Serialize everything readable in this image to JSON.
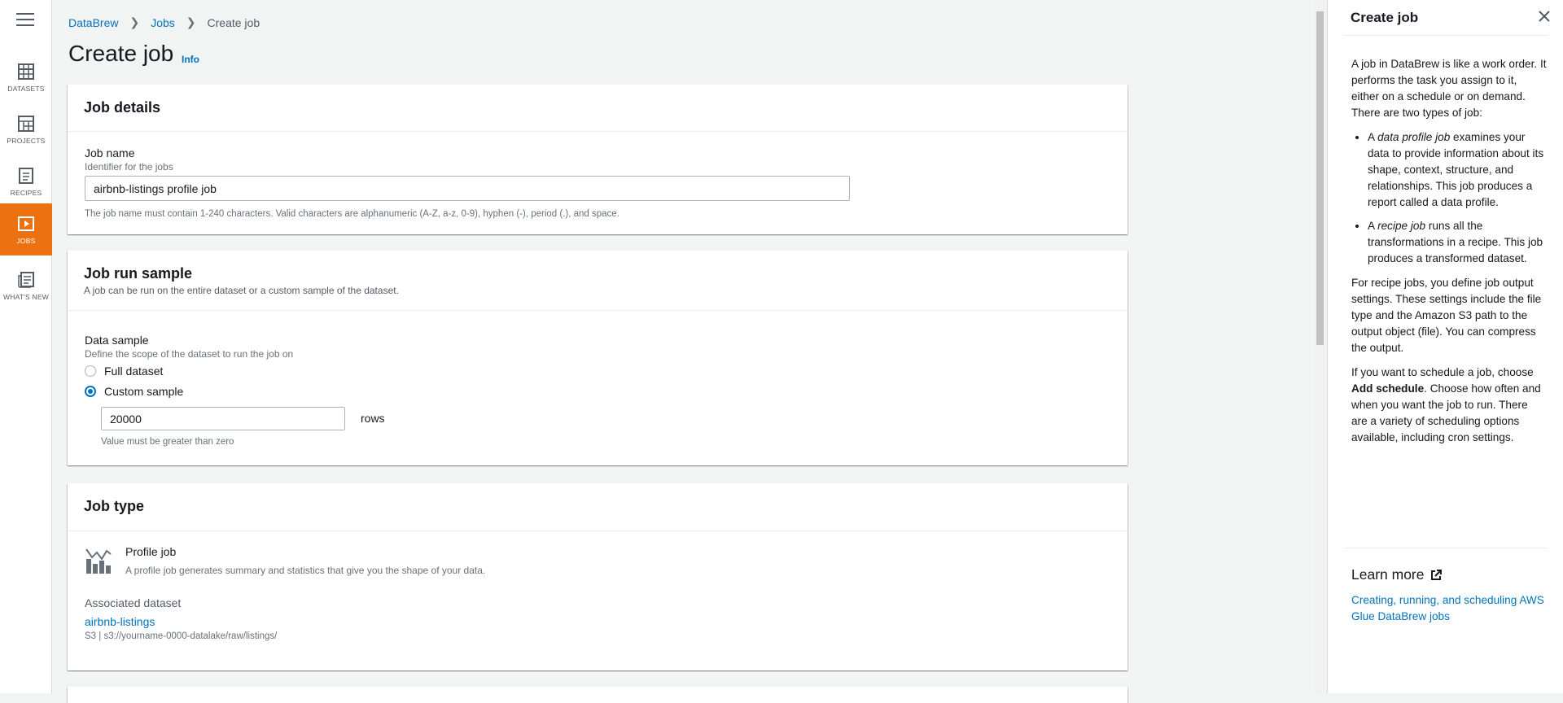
{
  "nav": {
    "items": [
      {
        "label": "DATASETS",
        "icon": "datasets-icon"
      },
      {
        "label": "PROJECTS",
        "icon": "projects-icon"
      },
      {
        "label": "RECIPES",
        "icon": "recipes-icon"
      },
      {
        "label": "JOBS",
        "icon": "jobs-icon",
        "active": true
      },
      {
        "label": "WHAT'S NEW",
        "icon": "whats-new-icon"
      }
    ],
    "active_color": "#ec7211"
  },
  "breadcrumb": {
    "items": [
      "DataBrew",
      "Jobs"
    ],
    "current": "Create job"
  },
  "page": {
    "title": "Create job",
    "info_label": "Info"
  },
  "job_details": {
    "heading": "Job details",
    "name_label": "Job name",
    "name_sublabel": "Identifier for the jobs",
    "name_value": "airbnb-listings profile job",
    "name_hint": "The job name must contain 1-240 characters. Valid characters are alphanumeric (A-Z, a-z, 0-9), hyphen (-), period (.), and space."
  },
  "job_run_sample": {
    "heading": "Job run sample",
    "description": "A job can be run on the entire dataset or a custom sample of the dataset.",
    "data_sample_label": "Data sample",
    "data_sample_sublabel": "Define the scope of the dataset to run the job on",
    "options": [
      {
        "label": "Full dataset",
        "selected": false
      },
      {
        "label": "Custom sample",
        "selected": true
      }
    ],
    "rows_value": "20000",
    "rows_unit": "rows",
    "rows_hint": "Value must be greater than zero"
  },
  "job_type": {
    "heading": "Job type",
    "type_title": "Profile job",
    "type_description": "A profile job generates summary and statistics that give you the shape of your data.",
    "associated_label": "Associated dataset",
    "dataset_name": "airbnb-listings",
    "dataset_path": "S3 | s3://yourname-0000-datalake/raw/listings/"
  },
  "help": {
    "title": "Create job",
    "intro": "A job in DataBrew is like a work order. It performs the task you assign to it, either on a schedule or on demand. There are two types of job:",
    "bullet1_pre": "A ",
    "bullet1_em": "data profile job",
    "bullet1_post": " examines your data to provide information about its shape, context, structure, and relationships. This job produces a report called a data profile.",
    "bullet2_pre": "A ",
    "bullet2_em": "recipe job",
    "bullet2_post": " runs all the transformations in a recipe. This job produces a transformed dataset.",
    "recipe_para": "For recipe jobs, you define job output settings. These settings include the file type and the Amazon S3 path to the output object (file). You can compress the output.",
    "schedule_pre": "If you want to schedule a job, choose ",
    "schedule_strong": "Add schedule",
    "schedule_post": ". Choose how often and when you want the job to run. There are a variety of scheduling options available, including cron settings.",
    "learn_more": "Learn more",
    "link": "Creating, running, and scheduling AWS Glue DataBrew jobs"
  }
}
